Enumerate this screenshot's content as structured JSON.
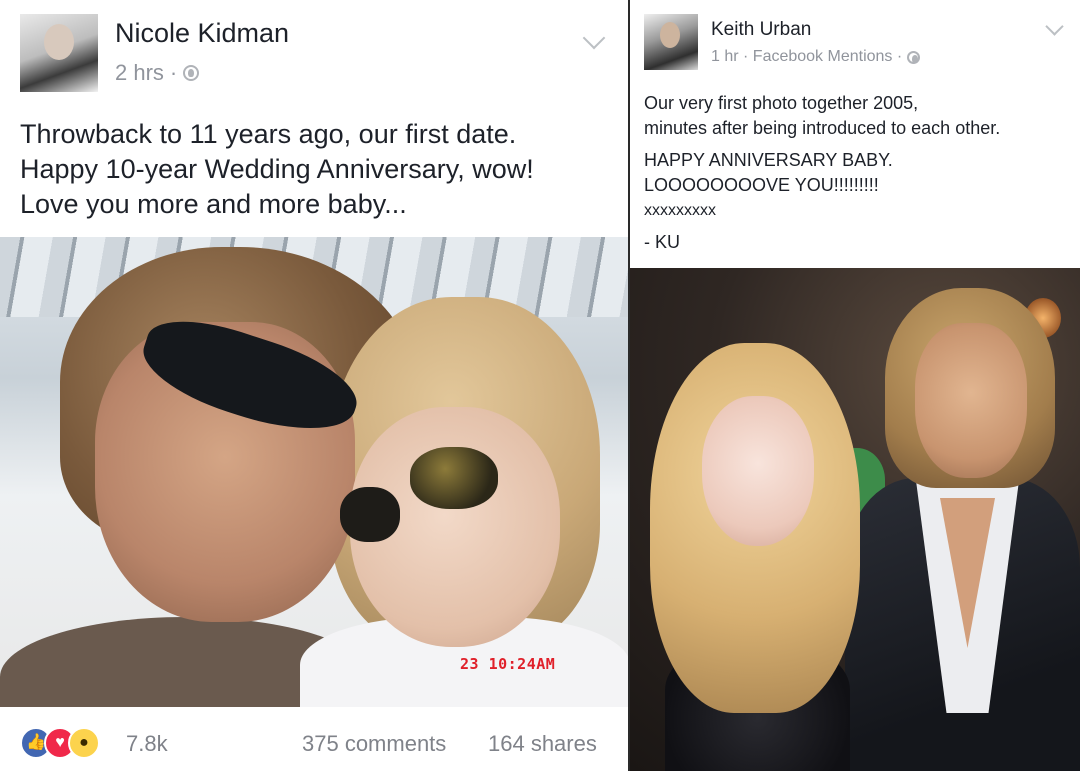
{
  "left_post": {
    "author": "Nicole Kidman",
    "time": "2 hrs",
    "separator": "·",
    "caption_lines": [
      "Throwback to 11 years ago, our first date.",
      "Happy 10-year Wedding Anniversary, wow!",
      "Love you more and more baby..."
    ],
    "photo_timestamp": "23  10:24AM",
    "reactions": {
      "icons": [
        "like-icon",
        "love-icon",
        "wow-icon"
      ],
      "count": "7.8k",
      "comments": "375 comments",
      "shares": "164 shares"
    }
  },
  "right_post": {
    "author": "Keith Urban",
    "meta": "1 hr · Facebook Mentions ·",
    "caption_lines": [
      "Our very first photo together 2005,",
      "minutes after being introduced to each other.",
      "HAPPY ANNIVERSARY BABY.",
      "LOOOOOOOOVE YOU!!!!!!!!!",
      "xxxxxxxxx",
      "- KU"
    ]
  },
  "colors": {
    "name_text": "#1d2129",
    "meta_text": "#90949c",
    "like_blue": "#4267b2",
    "love_red": "#f0284a",
    "wow_yellow": "#fcd34d",
    "timestamp_red": "#e0202a"
  }
}
